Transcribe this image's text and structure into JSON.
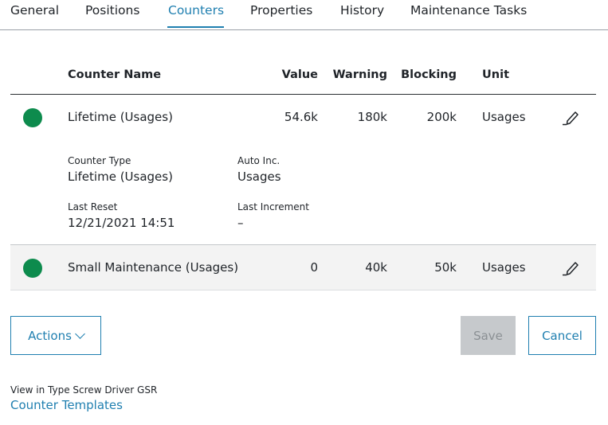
{
  "tabs": [
    {
      "label": "General",
      "active": false
    },
    {
      "label": "Positions",
      "active": false
    },
    {
      "label": "Counters",
      "active": true
    },
    {
      "label": "Properties",
      "active": false
    },
    {
      "label": "History",
      "active": false
    },
    {
      "label": "Maintenance Tasks",
      "active": false
    }
  ],
  "table": {
    "headers": {
      "name": "Counter Name",
      "value": "Value",
      "warning": "Warning",
      "blocking": "Blocking",
      "unit": "Unit"
    },
    "rows": [
      {
        "status_color": "#0d8b4d",
        "name": "Lifetime (Usages)",
        "value": "54.6k",
        "warning": "180k",
        "blocking": "200k",
        "unit": "Usages",
        "expanded": true,
        "details": {
          "counter_type_label": "Counter Type",
          "counter_type": "Lifetime (Usages)",
          "auto_inc_label": "Auto Inc.",
          "auto_inc": "Usages",
          "last_reset_label": "Last Reset",
          "last_reset": "12/21/2021 14:51",
          "last_increment_label": "Last Increment",
          "last_increment": "–"
        }
      },
      {
        "status_color": "#0d8b4d",
        "name": "Small Maintenance (Usages)",
        "value": "0",
        "warning": "40k",
        "blocking": "50k",
        "unit": "Usages",
        "expanded": false
      }
    ]
  },
  "buttons": {
    "actions": "Actions",
    "save": "Save",
    "cancel": "Cancel"
  },
  "footer": {
    "label": "View in Type Screw Driver GSR",
    "link": "Counter Templates"
  },
  "colors": {
    "accent": "#1f7fb0",
    "status_ok": "#0d8b4d",
    "disabled": "#c6c9cc"
  }
}
